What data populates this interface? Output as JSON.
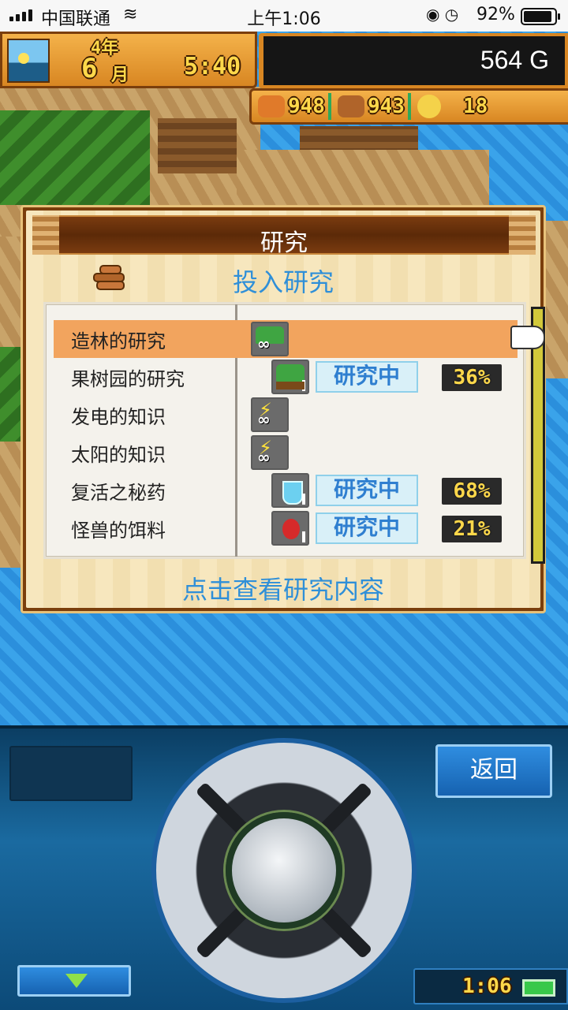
{
  "status_bar": {
    "carrier": "中国联通",
    "time": "上午1:06",
    "battery_percent": "92%",
    "battery_level": 0.92
  },
  "hud": {
    "year_num": "4",
    "year_unit": "年",
    "month_num": "6",
    "month_unit": "月",
    "time": "5:40",
    "money": "564 G",
    "resources": [
      {
        "icon": "food-icon",
        "value": "948"
      },
      {
        "icon": "wood-icon",
        "value": "943"
      },
      {
        "icon": "coin-icon",
        "value": "18"
      }
    ]
  },
  "dialog": {
    "title": "研究",
    "invest_label": "投入研究",
    "hint": "点击查看研究内容",
    "items": [
      {
        "name": "造林的研究",
        "icon": "forest-icon",
        "selected": true
      },
      {
        "name": "果树园的研究",
        "icon": "orchard-icon",
        "status": "研究中",
        "percent": "36%"
      },
      {
        "name": "发电的知识",
        "icon": "lightning-icon"
      },
      {
        "name": "太阳的知识",
        "icon": "lightning-icon"
      },
      {
        "name": "复活之秘药",
        "icon": "potion-icon",
        "status": "研究中",
        "percent": "68%"
      },
      {
        "name": "怪兽的饵料",
        "icon": "fruit-icon",
        "status": "研究中",
        "percent": "21%"
      }
    ]
  },
  "controls": {
    "back_label": "返回",
    "clock": "1:06"
  },
  "colors": {
    "selected_row": "#f2a45e",
    "accent_blue": "#2f8fd8",
    "hud_orange": "#d88622"
  }
}
